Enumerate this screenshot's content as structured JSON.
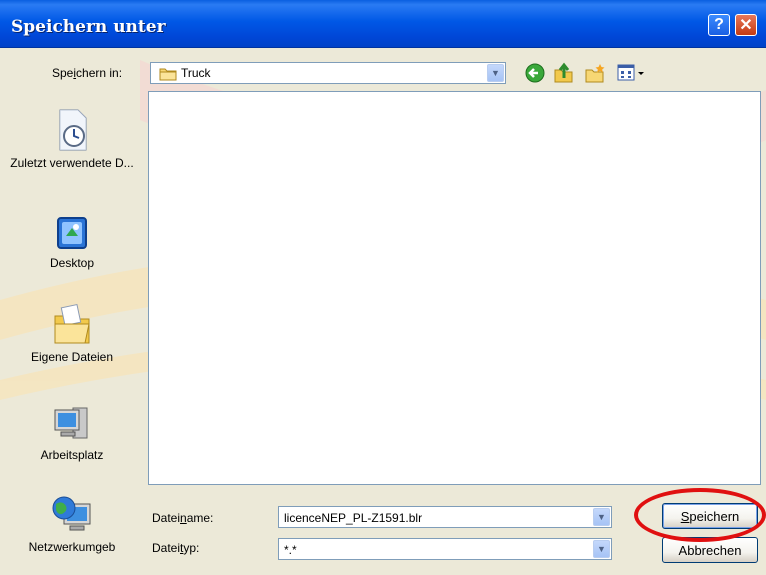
{
  "window": {
    "title": "Speichern unter",
    "help_glyph": "?",
    "close_glyph": "✕"
  },
  "save_in": {
    "label_pre": "Spe",
    "label_key": "i",
    "label_post": "chern in:",
    "value": "Truck",
    "icon": "folder-icon"
  },
  "toolbar": {
    "icons": [
      "back-icon",
      "up-folder-icon",
      "new-folder-icon",
      "view-menu-icon"
    ]
  },
  "places": [
    {
      "label": "Zuletzt verwendete D...",
      "icon": "recent-documents-icon"
    },
    {
      "label": "Desktop",
      "icon": "desktop-icon"
    },
    {
      "label": "Eigene Dateien",
      "icon": "my-documents-icon"
    },
    {
      "label": "Arbeitsplatz",
      "icon": "my-computer-icon"
    },
    {
      "label": "Netzwerkumgeb",
      "icon": "network-icon"
    }
  ],
  "file_list": {
    "items": []
  },
  "filename": {
    "label_pre": "Datei",
    "label_key": "n",
    "label_post": "ame:",
    "value": "licenceNEP_PL-Z1591.blr"
  },
  "filetype": {
    "label_pre": "Datei",
    "label_key": "t",
    "label_post": "yp:",
    "value": "*.*"
  },
  "buttons": {
    "save_key": "S",
    "save_rest": "peichern",
    "cancel": "Abbrechen"
  },
  "colors": {
    "titlebar": "#0054e3",
    "highlight": "#e01010",
    "watermark": "#f4c0c0"
  }
}
